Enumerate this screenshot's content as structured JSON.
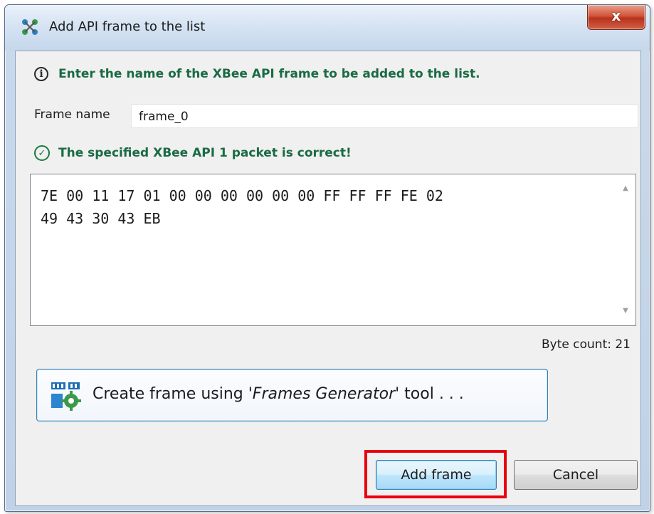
{
  "window": {
    "title": "Add API frame to the list",
    "close_label": "x"
  },
  "info": {
    "message": "Enter the name of the XBee API frame to be added to the list."
  },
  "frame_name": {
    "label": "Frame name",
    "value": "frame_0"
  },
  "validation": {
    "message": "The specified XBee API 1 packet is correct!"
  },
  "hex": {
    "line1": "7E 00 11 17 01 00 00 00 00 00 00 FF FF FF FE 02",
    "line2": "49 43 30 43 EB"
  },
  "byte_count": "Byte count: 21",
  "generator_button": {
    "prefix": "Create frame using '",
    "tool_name": "Frames Generator",
    "suffix": "' tool . . ."
  },
  "buttons": {
    "add": "Add frame",
    "cancel": "Cancel"
  },
  "colors": {
    "message_green": "#1a6b44",
    "highlight_red": "#e8000f",
    "close_red": "#c8432a"
  }
}
